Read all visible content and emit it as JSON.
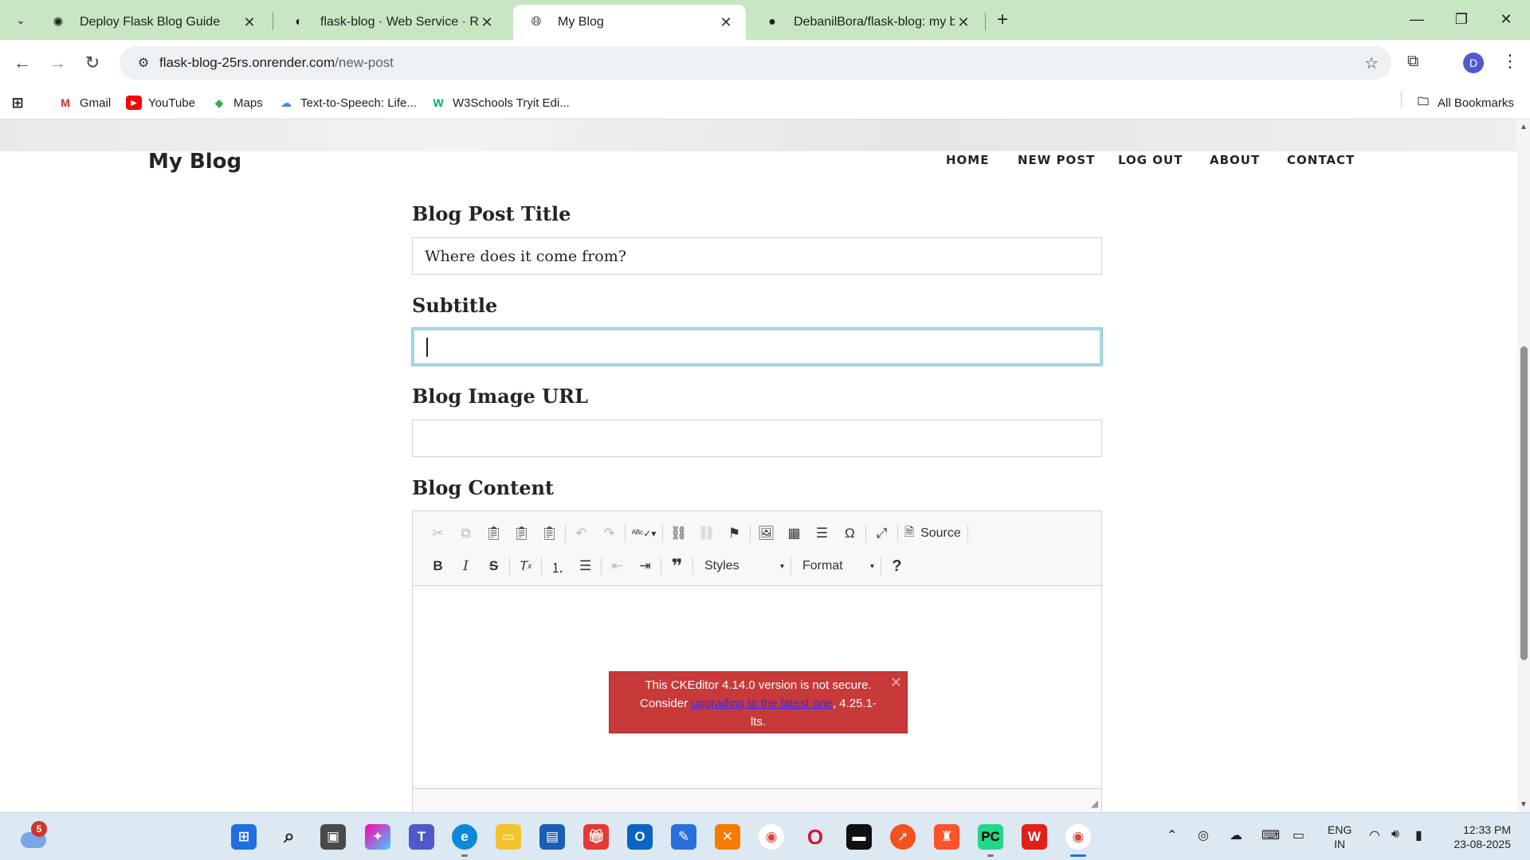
{
  "browser": {
    "tabs": [
      {
        "title": "Deploy Flask Blog Guide",
        "icon": "openai-icon"
      },
      {
        "title": "flask-blog · Web Service · Render",
        "icon": "render-icon"
      },
      {
        "title": "My Blog",
        "icon": "globe-icon"
      },
      {
        "title": "DebanilBora/flask-blog: my blog",
        "icon": "github-icon"
      }
    ],
    "url_host": "flask-blog-25rs.onrender.com",
    "url_path": "/new-post",
    "bookmarks": [
      {
        "label": "Gmail",
        "icon": "gmail-icon"
      },
      {
        "label": "YouTube",
        "icon": "youtube-icon"
      },
      {
        "label": "Maps",
        "icon": "maps-icon"
      },
      {
        "label": "Text-to-Speech: Life...",
        "icon": "cloud-icon"
      },
      {
        "label": "W3Schools Tryit Edi...",
        "icon": "w3schools-icon"
      }
    ],
    "all_bookmarks": "All Bookmarks",
    "profile_initial": "D"
  },
  "site": {
    "brand": "My Blog",
    "nav": [
      "HOME",
      "NEW POST",
      "LOG OUT",
      "ABOUT",
      "CONTACT"
    ]
  },
  "form": {
    "title_label": "Blog Post Title",
    "title_value": "Where does it come from?",
    "subtitle_label": "Subtitle",
    "subtitle_value": "",
    "image_label": "Blog Image URL",
    "image_value": "",
    "content_label": "Blog Content"
  },
  "editor": {
    "source_label": "Source",
    "styles_label": "Styles",
    "format_label": "Format",
    "help_label": "?",
    "warning_line1": "This CKEditor 4.14.0 version is not secure.",
    "warning_consider": "Consider ",
    "warning_link": "upgrading to the latest one",
    "warning_tail": ", 4.25.1-lts."
  },
  "taskbar": {
    "weather_badge": "5",
    "lang_line1": "ENG",
    "lang_line2": "IN",
    "time": "12:33 PM",
    "date": "23-08-2025"
  },
  "colors": {
    "tabstrip": "#c8e6c4",
    "warning_bg": "#c83939",
    "focus_ring": "#a7d8e6",
    "avatar": "#4f5bd5"
  }
}
